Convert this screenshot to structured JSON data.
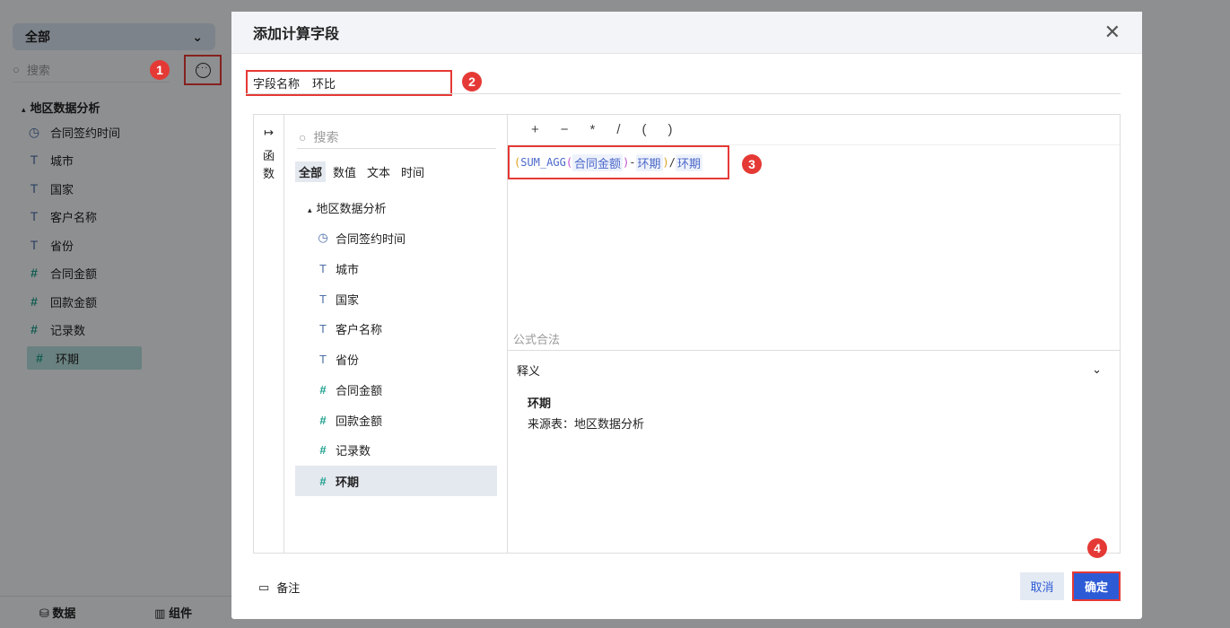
{
  "left_panel": {
    "scope_label": "全部",
    "search_placeholder": "搜索",
    "tree_title": "地区数据分析",
    "items": [
      {
        "label": "合同签约时间",
        "icon": "clock-icon"
      },
      {
        "label": "城市",
        "icon": "text-type-icon"
      },
      {
        "label": "国家",
        "icon": "text-type-icon"
      },
      {
        "label": "客户名称",
        "icon": "text-type-icon"
      },
      {
        "label": "省份",
        "icon": "text-type-icon"
      },
      {
        "label": "合同金额",
        "icon": "number-icon"
      },
      {
        "label": "回款金额",
        "icon": "number-icon"
      },
      {
        "label": "记录数",
        "icon": "count-number-icon"
      },
      {
        "label": "环期",
        "icon": "calc-number-icon"
      }
    ],
    "bottom_tabs": [
      "数据",
      "组件"
    ]
  },
  "badges": [
    "1",
    "2",
    "3",
    "4"
  ],
  "modal": {
    "title": "添加计算字段",
    "field_name_label": "字段名称",
    "field_name_value": "环比",
    "tab_label": "函数",
    "search_placeholder": "搜索",
    "filter_tabs": [
      "全部",
      "数值",
      "文本",
      "时间"
    ],
    "tree_title": "地区数据分析",
    "operators": [
      "+",
      "−",
      "*",
      "/",
      "(",
      ")"
    ],
    "formula": {
      "open": "(",
      "func": "SUM_AGG",
      "open2": "(",
      "field1": "合同金额",
      "close2": ")",
      "minus": "-",
      "field2": "环期",
      "close": ")",
      "slash": "/",
      "field3": "环期"
    },
    "validity": "公式合法",
    "explain_title": "释义",
    "explain_name": "环期",
    "explain_source": "来源表：地区数据分析",
    "note_label": "备注",
    "cancel_label": "取消",
    "ok_label": "确定"
  }
}
